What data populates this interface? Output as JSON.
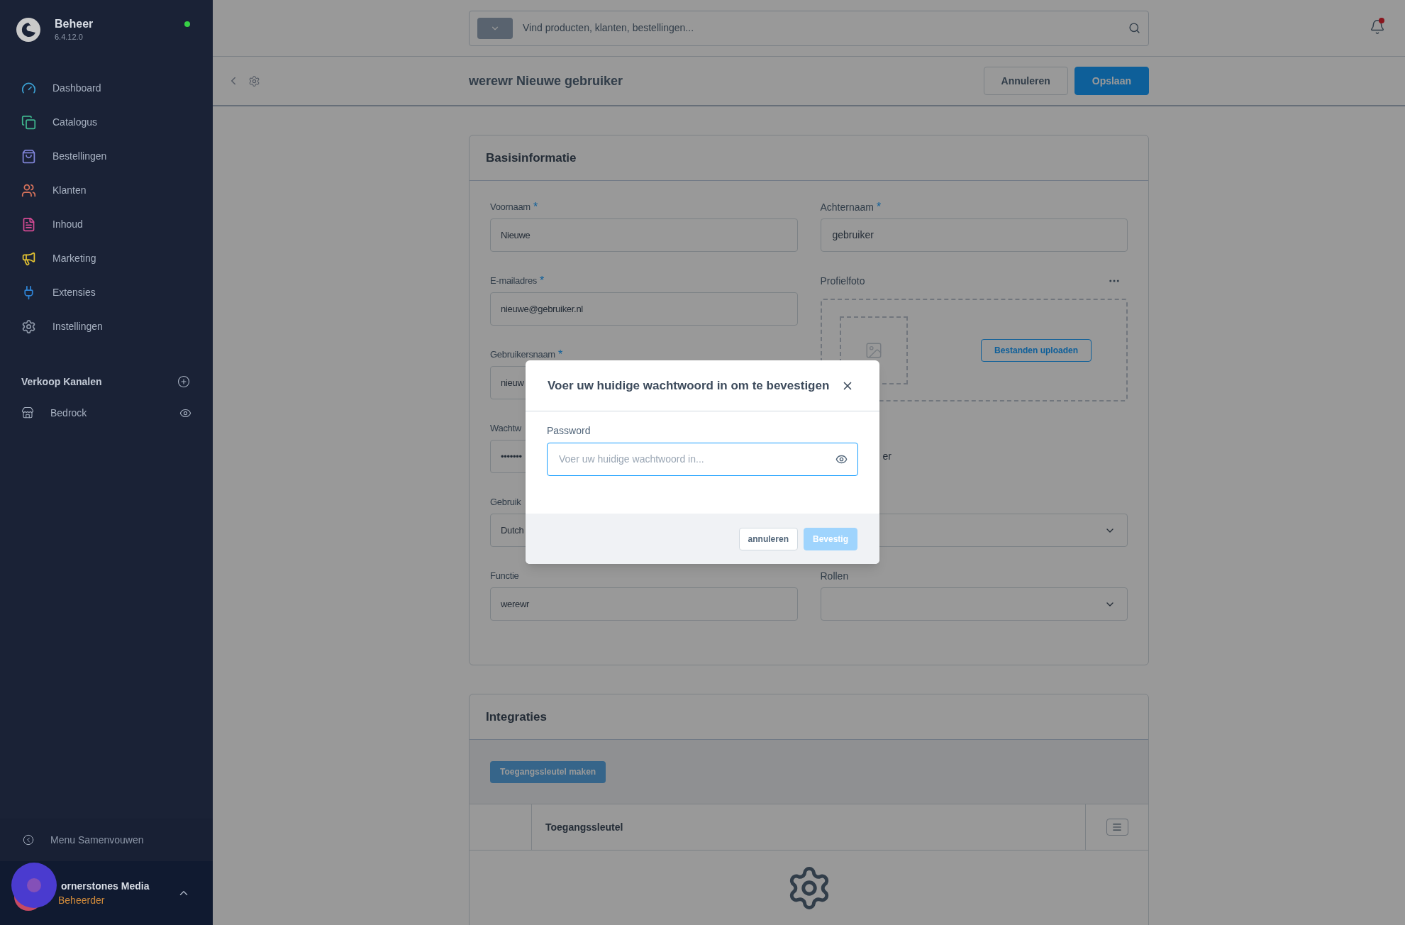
{
  "sidebar": {
    "brand": {
      "title": "Beheer",
      "version": "6.4.12.0",
      "online": true
    },
    "nav": [
      {
        "label": "Dashboard",
        "color": "#3b9fd1"
      },
      {
        "label": "Catalogus",
        "color": "#3fb68e"
      },
      {
        "label": "Bestellingen",
        "color": "#7f83d6"
      },
      {
        "label": "Klanten",
        "color": "#d8735c"
      },
      {
        "label": "Inhoud",
        "color": "#d24a93"
      },
      {
        "label": "Marketing",
        "color": "#e2c232"
      },
      {
        "label": "Extensies",
        "color": "#2f84d6"
      },
      {
        "label": "Instellingen",
        "color": "#8c96a6"
      }
    ],
    "sales_channels": {
      "title": "Verkoop Kanalen",
      "items": [
        {
          "label": "Bedrock"
        }
      ]
    },
    "collapse": "Menu Samenvouwen",
    "user": {
      "name": "ornerstones Media",
      "role": "Beheerder"
    }
  },
  "topbar": {
    "search": {
      "placeholder": "Vind producten, klanten, bestellingen..."
    },
    "notifications": {
      "unread": true
    }
  },
  "page_header": {
    "title": "werewr Nieuwe gebruiker",
    "buttons": [
      {
        "label": "Annuleren",
        "kind": "secondary"
      },
      {
        "label": "Opslaan",
        "kind": "primary"
      }
    ]
  },
  "basic_info": {
    "title": "Basisinformatie",
    "left_fields": [
      {
        "label": "Voornaam",
        "required_mark": "*",
        "value": "Nieuwe"
      },
      {
        "label": "E-mailadres",
        "required_mark": "*",
        "value": "nieuwe@gebruiker.nl"
      },
      {
        "label": "Gebruikersnaam",
        "required_mark": "*",
        "value": "nieuw"
      },
      {
        "label": "Wachtw",
        "value": "•••••••"
      },
      {
        "label": "Gebruik",
        "value": "Dutch"
      },
      {
        "label": "Functie",
        "value": "werewr"
      }
    ],
    "right_fields": [
      {
        "kind": "text",
        "label": "Achternaam",
        "required_mark": "*",
        "value": "gebruiker"
      },
      {
        "kind": "image",
        "label": "Profielfoto",
        "button": "Bestanden uploaden"
      },
      {
        "kind": "checkbox",
        "text": "er"
      },
      {
        "kind": "select"
      },
      {
        "kind": "select",
        "label": "Rollen"
      }
    ]
  },
  "integrations": {
    "title": "Integraties",
    "button": {
      "label": "Toegangssleutel maken",
      "disabled": true
    },
    "table": {
      "columns": [
        "Toegangssleutel"
      ]
    }
  },
  "modal": {
    "title": "Voer uw huidige wachtwoord in om te bevestigen",
    "field": {
      "label": "Password",
      "placeholder": "Voer uw huidige wachtwoord in..."
    },
    "buttons": [
      {
        "label": "annuleren",
        "kind": "secondary"
      },
      {
        "label": "Bevestig",
        "kind": "primary",
        "disabled": true
      }
    ]
  }
}
